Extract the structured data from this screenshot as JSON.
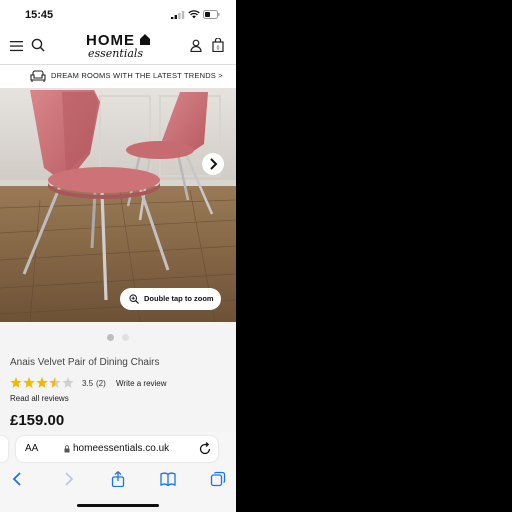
{
  "status_bar": {
    "time": "15:45"
  },
  "header": {
    "logo_top": "HOME",
    "logo_bottom": "essentials"
  },
  "promo": {
    "text": "DREAM ROOMS WITH THE LATEST TRENDS  >"
  },
  "gallery": {
    "zoom_hint": "Double tap to zoom",
    "slide_count": 2,
    "active_slide": 1
  },
  "product": {
    "name": "Anais Velvet Pair of Dining Chairs",
    "rating_value": "3.5",
    "rating_count": "(2)",
    "rating_stars": 3.5,
    "write_review": "Write a review",
    "read_all": "Read all reviews",
    "price": "£159.00"
  },
  "browser": {
    "aa_label": "AA",
    "url": "homeessentials.co.uk"
  },
  "colors": {
    "star": "#f5b800",
    "star_empty": "#cfcfcf",
    "chair_velvet": "#c96a6f",
    "floor": "#8a6a48",
    "ios_blue": "#1a73e8"
  }
}
